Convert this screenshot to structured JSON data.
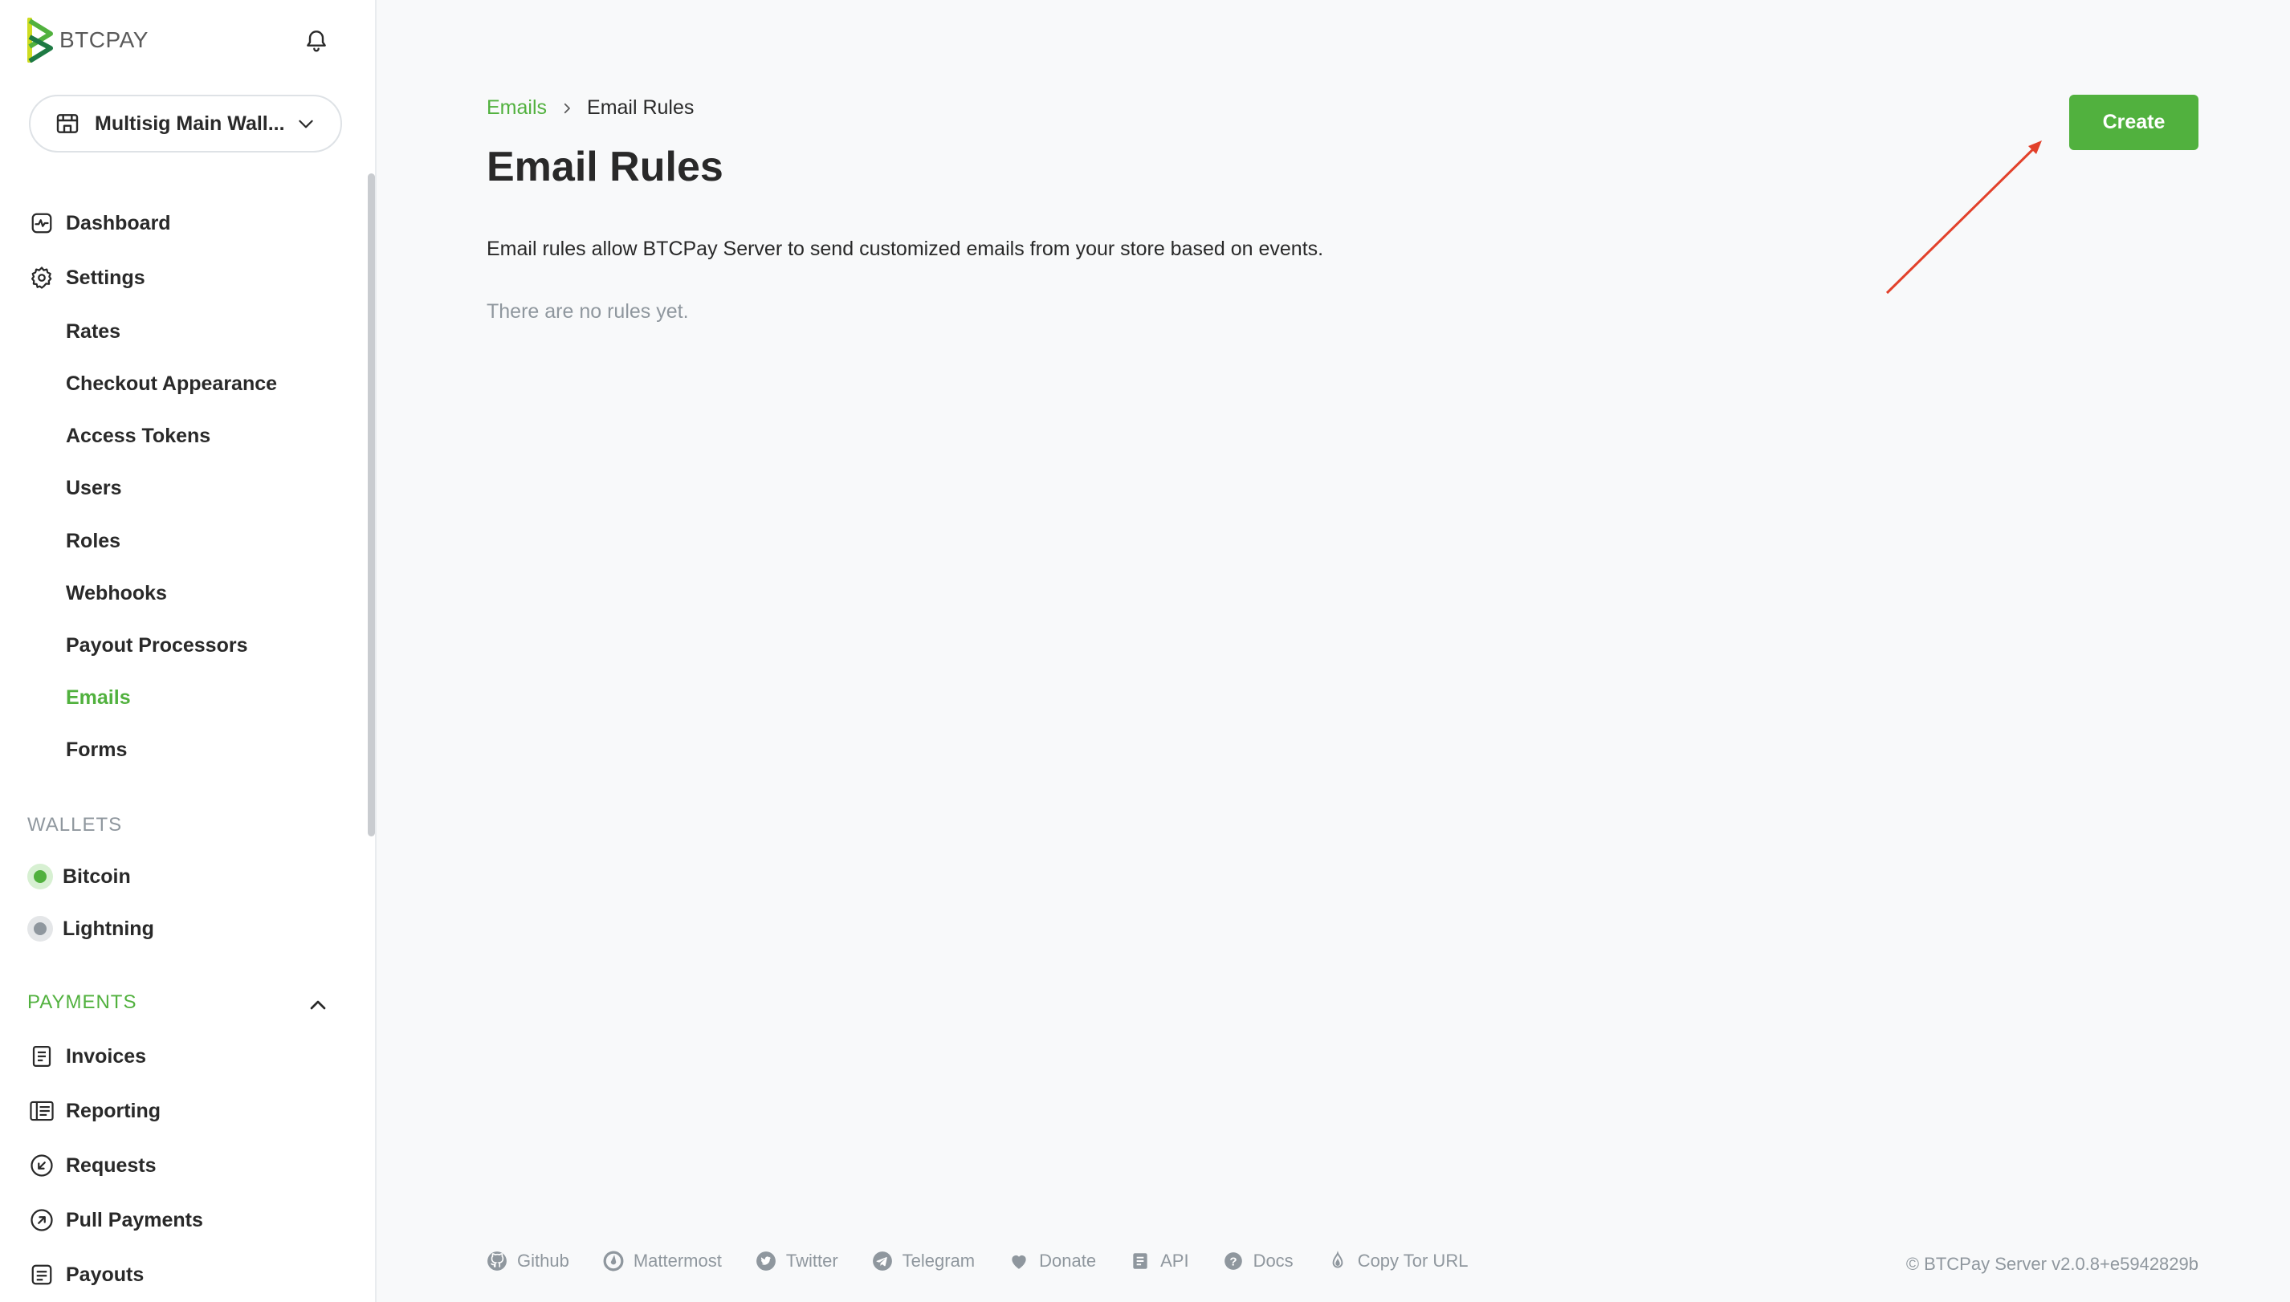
{
  "brand": {
    "logo_text": "BTCPAY",
    "accent": "#51b13e"
  },
  "store": {
    "name": "Multisig Main Wall..."
  },
  "nav": {
    "dashboard": "Dashboard",
    "settings": "Settings",
    "settings_items": [
      {
        "label": "Rates"
      },
      {
        "label": "Checkout Appearance"
      },
      {
        "label": "Access Tokens"
      },
      {
        "label": "Users"
      },
      {
        "label": "Roles"
      },
      {
        "label": "Webhooks"
      },
      {
        "label": "Payout Processors"
      },
      {
        "label": "Emails",
        "active": true
      },
      {
        "label": "Forms"
      }
    ],
    "wallets_heading": "WALLETS",
    "wallets": [
      {
        "label": "Bitcoin",
        "status": "enabled"
      },
      {
        "label": "Lightning",
        "status": "disabled"
      }
    ],
    "payments_heading": "PAYMENTS",
    "payments": [
      {
        "label": "Invoices",
        "icon": "invoice-icon"
      },
      {
        "label": "Reporting",
        "icon": "reporting-icon"
      },
      {
        "label": "Requests",
        "icon": "requests-icon"
      },
      {
        "label": "Pull Payments",
        "icon": "pull-payments-icon"
      },
      {
        "label": "Payouts",
        "icon": "payouts-icon"
      }
    ]
  },
  "breadcrumb": {
    "parent": "Emails",
    "current": "Email Rules"
  },
  "page": {
    "title": "Email Rules",
    "create_label": "Create",
    "description": "Email rules allow BTCPay Server to send customized emails from your store based on events.",
    "empty_message": "There are no rules yet."
  },
  "footer": {
    "links": [
      {
        "label": "Github",
        "icon": "github-icon"
      },
      {
        "label": "Mattermost",
        "icon": "mattermost-icon"
      },
      {
        "label": "Twitter",
        "icon": "twitter-icon"
      },
      {
        "label": "Telegram",
        "icon": "telegram-icon"
      },
      {
        "label": "Donate",
        "icon": "heart-icon"
      },
      {
        "label": "API",
        "icon": "api-icon"
      },
      {
        "label": "Docs",
        "icon": "docs-icon"
      },
      {
        "label": "Copy Tor URL",
        "icon": "tor-icon"
      }
    ],
    "copyright": "© BTCPay Server v2.0.8+e5942829b"
  }
}
